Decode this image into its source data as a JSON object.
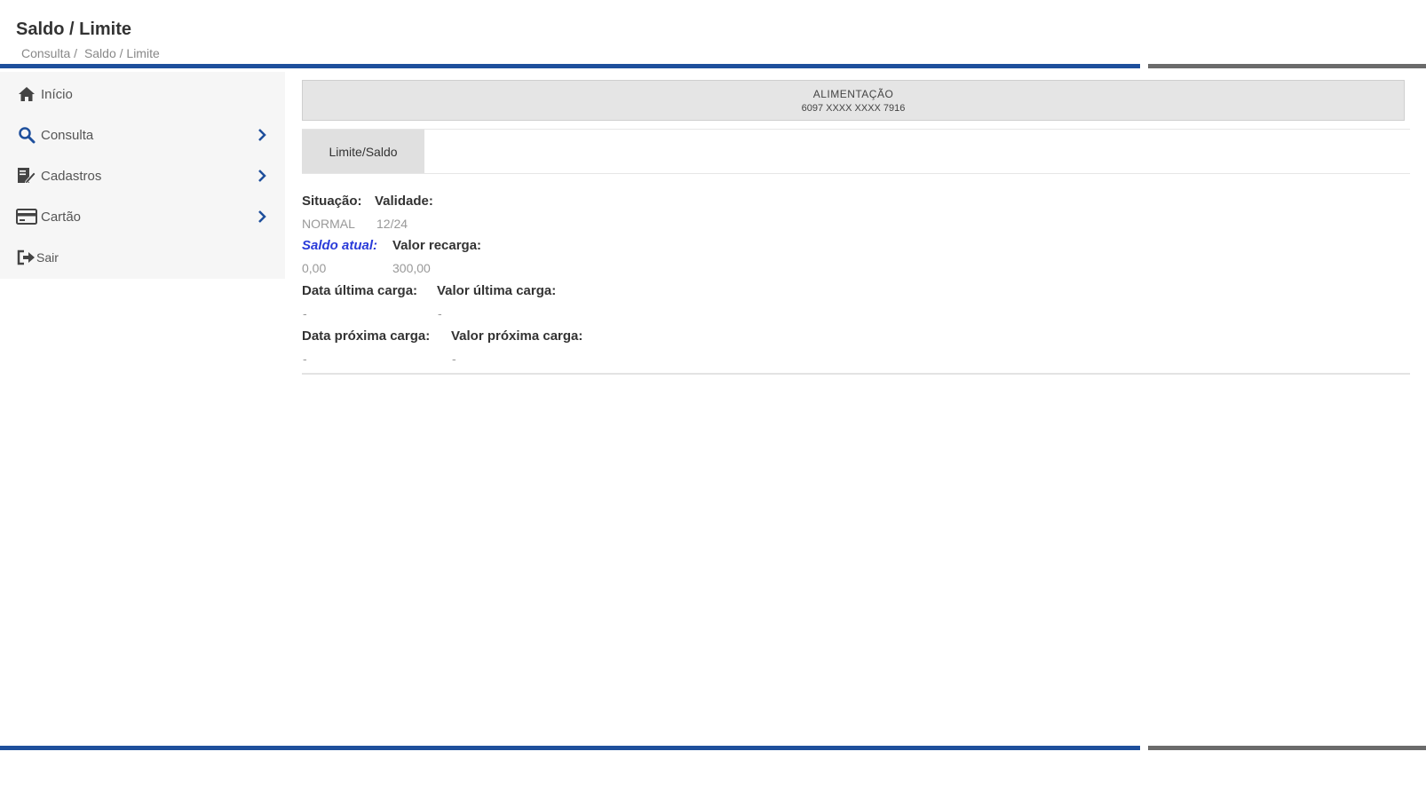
{
  "header": {
    "title": "Saldo / Limite",
    "breadcrumb": [
      "Consulta /",
      "Saldo / Limite"
    ]
  },
  "sidebar": {
    "items": [
      {
        "label": "Início",
        "icon": "home-icon"
      },
      {
        "label": "Consulta",
        "icon": "search-icon"
      },
      {
        "label": "Cadastros",
        "icon": "edit-document-icon"
      },
      {
        "label": "Cartão",
        "icon": "credit-card-icon"
      },
      {
        "label": "Sair",
        "icon": "sign-out-icon"
      }
    ]
  },
  "card": {
    "type": "ALIMENTAÇÃO",
    "number": "6097 XXXX XXXX 7916"
  },
  "tabs": [
    {
      "label": "Limite/Saldo",
      "active": true
    }
  ],
  "details": {
    "situacao": {
      "label": "Situação:",
      "value": "NORMAL"
    },
    "validade": {
      "label": "Validade:",
      "value": "12/24"
    },
    "saldo_atual": {
      "label": "Saldo atual:",
      "value": "0,00"
    },
    "valor_recarga": {
      "label": "Valor recarga:",
      "value": "300,00"
    },
    "data_ultima_carga": {
      "label": "Data última carga:",
      "value": "-"
    },
    "valor_ultima_carga": {
      "label": "Valor última carga:",
      "value": "-"
    },
    "data_proxima_carga": {
      "label": "Data próxima carga:",
      "value": "-"
    },
    "valor_proxima_carga": {
      "label": "Valor próxima carga:",
      "value": "-"
    }
  },
  "colors": {
    "primary_blue": "#1e4f9c",
    "secondary_gray": "#6b6b6b",
    "link_blue": "#2a3bd9",
    "sidebar_bg": "#f6f6f6"
  }
}
